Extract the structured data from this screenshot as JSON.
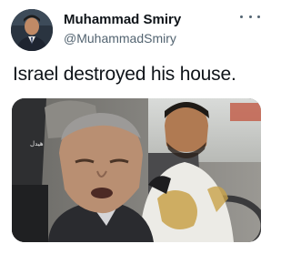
{
  "author": {
    "display_name": "Muhammad Smiry",
    "handle": "@MuhammadSmiry",
    "avatar_icon": "user-avatar-icon"
  },
  "tweet": {
    "text": "Israel destroyed his house."
  },
  "menu": {
    "icon": "more-options-icon"
  },
  "media": {
    "type": "video-still",
    "overlay_logo_text": "هيدل"
  },
  "colors": {
    "name": "#0f1419",
    "handle": "#536471",
    "background": "#ffffff"
  }
}
